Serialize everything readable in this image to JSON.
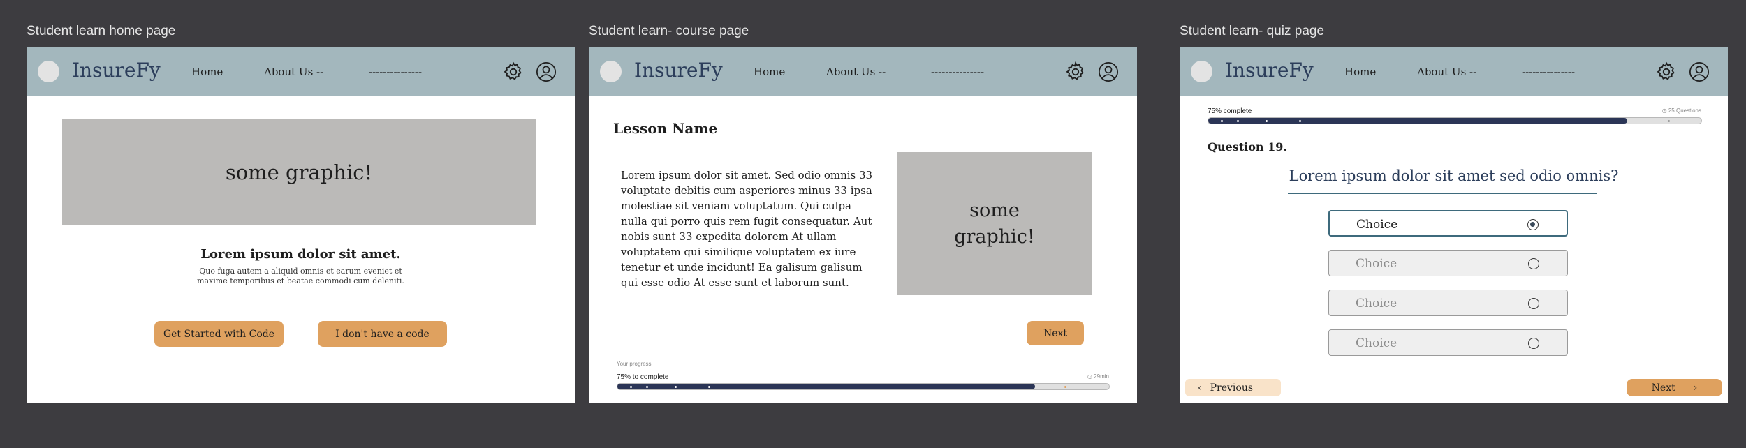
{
  "frames": {
    "home": {
      "label": "Student learn home page"
    },
    "course": {
      "label": "Student learn- course page"
    },
    "quiz": {
      "label": "Student learn- quiz page"
    }
  },
  "nav": {
    "brand": "InsureFy",
    "home": "Home",
    "about": "About Us --",
    "placeholder": "---------------"
  },
  "home": {
    "graphic": "some graphic!",
    "heading": "Lorem ipsum dolor sit amet.",
    "sub_line1": "Quo fuga autem a aliquid omnis et earum eveniet et",
    "sub_line2": "maxime temporibus et beatae commodi cum deleniti.",
    "btn_code": "Get Started with Code",
    "btn_nocode": "I don't have a code"
  },
  "course": {
    "lesson": "Lesson Name",
    "body": "Lorem ipsum dolor sit amet. Sed odio omnis 33 voluptate debitis cum asperiores minus 33 ipsa molestiae sit veniam voluptatum. Qui culpa nulla qui porro quis rem fugit consequatur. Aut nobis sunt 33 expedita dolorem At ullam voluptatem qui similique voluptatem ex iure tenetur et unde incidunt! Ea galisum galisum qui esse odio At esse sunt et laborum sunt.",
    "graphic_line1": "some",
    "graphic_line2": "graphic!",
    "next": "Next",
    "progress_title": "Your progress",
    "progress_label": "75% to complete",
    "time": "29min",
    "progress": 0.85
  },
  "quiz": {
    "progress_label": "75% complete",
    "questions_count": "25 Questions",
    "progress": 0.85,
    "question_number": "Question 19.",
    "question": "Lorem ipsum dolor sit amet sed odio omnis?",
    "choices": [
      "Choice",
      "Choice",
      "Choice",
      "Choice"
    ],
    "selected_index": 0,
    "previous": "Previous",
    "next": "Next"
  },
  "colors": {
    "nav": "#a3b7bd",
    "accent": "#dfa15f",
    "progress": "#2b3556",
    "brand": "#2c3e5b"
  }
}
